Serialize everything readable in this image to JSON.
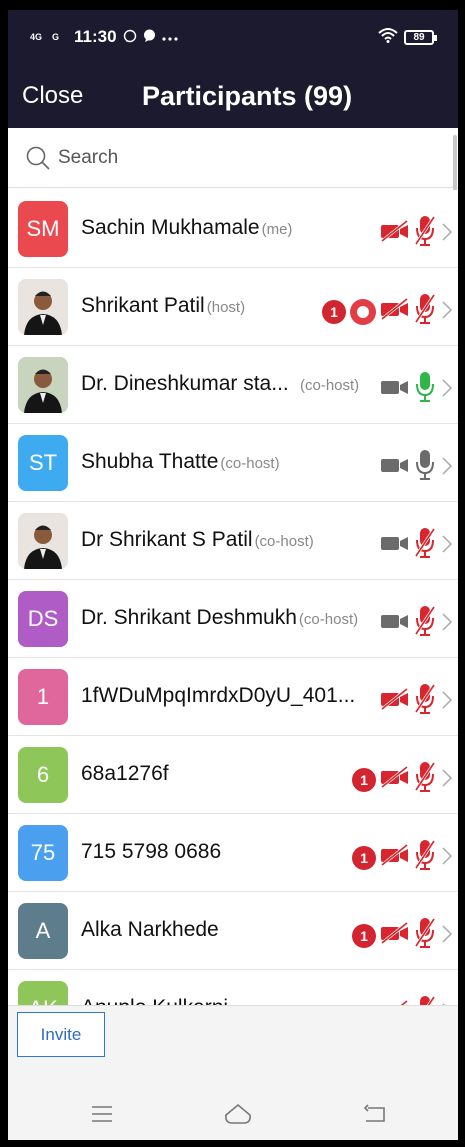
{
  "status_bar": {
    "network_1": "4G",
    "network_2": "G",
    "time": "11:30",
    "battery": "89"
  },
  "header": {
    "close_label": "Close",
    "title": "Participants (99)"
  },
  "search": {
    "placeholder": "Search",
    "value": ""
  },
  "participants": [
    {
      "name": "Sachin Mukhamale",
      "role": "(me)",
      "initials": "SM",
      "avatar_color": "#ea4a4f",
      "video": "off",
      "audio": "muted",
      "badge": "",
      "recording": false
    },
    {
      "name": "Shrikant Patil",
      "role": "(host)",
      "initials": "",
      "avatar_color": "#e9e4df",
      "video": "off",
      "audio": "muted",
      "badge": "1",
      "recording": true
    },
    {
      "name": "Dr. Dineshkumar sta...",
      "role": "(co-host)",
      "initials": "",
      "avatar_color": "#c9d4bf",
      "video": "on",
      "audio": "active",
      "badge": "",
      "recording": false
    },
    {
      "name": "Shubha Thatte",
      "role": "(co-host)",
      "initials": "ST",
      "avatar_color": "#3eaaf0",
      "video": "on",
      "audio": "unmuted",
      "badge": "",
      "recording": false
    },
    {
      "name": "Dr Shrikant S Patil",
      "role": "(co-host)",
      "initials": "",
      "avatar_color": "#e9e4df",
      "video": "on",
      "audio": "muted",
      "badge": "",
      "recording": false
    },
    {
      "name": "Dr. Shrikant Deshmukh",
      "role": "(co-host)",
      "initials": "DS",
      "avatar_color": "#b05cc6",
      "video": "on",
      "audio": "muted",
      "badge": "",
      "recording": false
    },
    {
      "name": "1fWDuMpqImrdxD0yU_401...",
      "role": "",
      "initials": "1",
      "avatar_color": "#e0679c",
      "video": "off",
      "audio": "muted",
      "badge": "",
      "recording": false
    },
    {
      "name": "68a1276f",
      "role": "",
      "initials": "6",
      "avatar_color": "#8fc65a",
      "video": "off",
      "audio": "muted",
      "badge": "1",
      "recording": false
    },
    {
      "name": "715 5798 0686",
      "role": "",
      "initials": "75",
      "avatar_color": "#4aa0ee",
      "video": "off",
      "audio": "muted",
      "badge": "1",
      "recording": false
    },
    {
      "name": "Alka Narkhede",
      "role": "",
      "initials": "A",
      "avatar_color": "#5e7d8c",
      "video": "off",
      "audio": "muted",
      "badge": "1",
      "recording": false
    },
    {
      "name": "Anuplo Kulkarni",
      "role": "",
      "initials": "AK",
      "avatar_color": "#8fc65a",
      "video": "off",
      "audio": "muted",
      "badge": "",
      "recording": false
    }
  ],
  "footer": {
    "invite_label": "Invite"
  },
  "colors": {
    "header_bg": "#1c1a2e",
    "muted_red": "#d9262e",
    "active_green": "#2fb54a",
    "neutral_icon": "#6b6b6b",
    "link_blue": "#2d76d9"
  },
  "icons": {
    "nav_menu": "menu-icon",
    "nav_home": "home-icon",
    "nav_back": "back-icon"
  }
}
